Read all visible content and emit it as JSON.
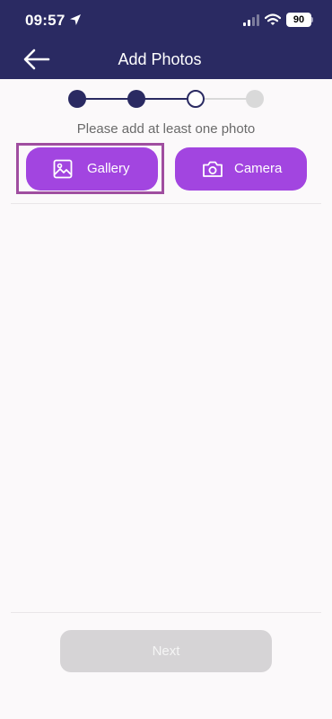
{
  "status_bar": {
    "time": "09:57",
    "battery": "90",
    "icons": [
      "location-arrow-icon",
      "cellular-signal-icon",
      "wifi-icon",
      "battery-icon"
    ]
  },
  "header": {
    "title": "Add Photos",
    "back_icon": "arrow-left-icon"
  },
  "stepper": {
    "total_steps": 4,
    "current_step": 3,
    "steps": [
      {
        "state": "completed"
      },
      {
        "state": "completed"
      },
      {
        "state": "current"
      },
      {
        "state": "upcoming"
      }
    ]
  },
  "main": {
    "hint": "Please add at least one photo",
    "gallery_button": {
      "label": "Gallery",
      "icon": "image-icon"
    },
    "camera_button": {
      "label": "Camera",
      "icon": "camera-icon"
    }
  },
  "footer": {
    "next_label": "Next"
  },
  "colors": {
    "header_bg": "#2a2a62",
    "accent": "#a245e0",
    "step_done": "#2a2a62",
    "step_upcoming": "#d9d9d9",
    "highlight": "#a04ea0",
    "disabled_button": "#d6d4d6",
    "page_bg": "#fbf9fa"
  }
}
